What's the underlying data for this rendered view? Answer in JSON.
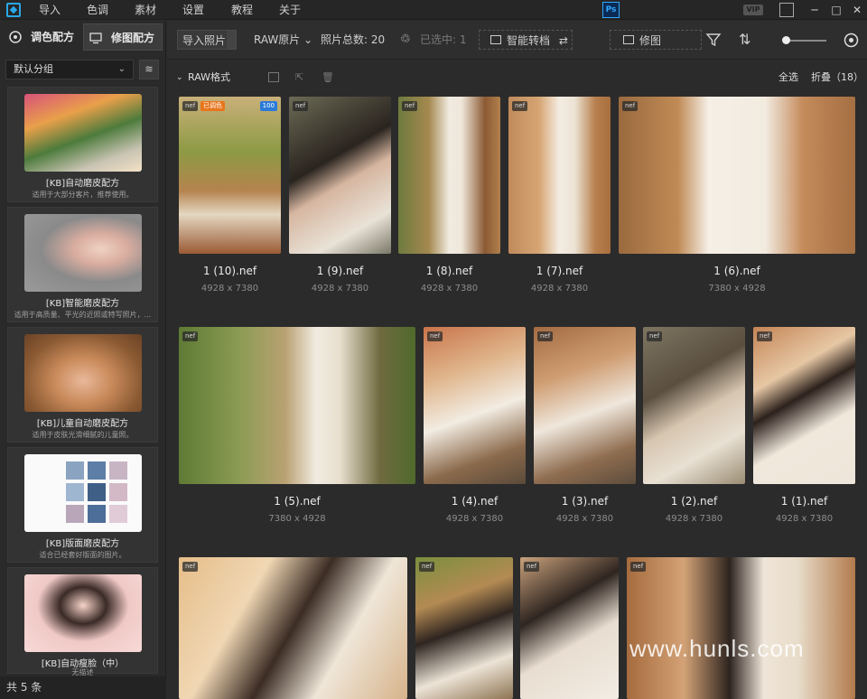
{
  "menubar": {
    "items": [
      "导入",
      "色调",
      "素材",
      "设置",
      "教程",
      "关于"
    ],
    "ps_label": "Ps",
    "vip_label": "VIP",
    "window_buttons": [
      "─",
      "□",
      "✕"
    ]
  },
  "sidebar": {
    "tabs": [
      {
        "label": "调色配方"
      },
      {
        "label": "修图配方"
      }
    ],
    "group_select": {
      "value": "默认分组"
    },
    "presets": [
      {
        "name": "[KB]自动磨皮配方",
        "desc": "适用于大部分客片，推荐使用。"
      },
      {
        "name": "[KB]智能磨皮配方",
        "desc": "适用于高质量、平光的近照或特写照片，..."
      },
      {
        "name": "[KB]儿童自动磨皮配方",
        "desc": "适用于皮肤光滑细腻的儿童照。"
      },
      {
        "name": "[KB]版面磨皮配方",
        "desc": "适合已经套好版面的图片。"
      },
      {
        "name": "[KB]自动瘦脸（中）",
        "desc": "无描述"
      }
    ],
    "footer": "共 5 条"
  },
  "toolbar": {
    "import_label": "导入照片",
    "raw_select": "RAW原片",
    "total_label": "照片总数:",
    "total_value": "20",
    "selected_label": "已选中:",
    "selected_value": "1",
    "smart_label": "智能转档",
    "retouch_label": "修图"
  },
  "section": {
    "title": "RAW格式",
    "select_all": "全选",
    "collapse": "折叠（18）"
  },
  "photos": [
    {
      "name": "1 (10).nef",
      "dims": "4928 x 7380",
      "badge": "nef",
      "status": "已调色",
      "score": "100"
    },
    {
      "name": "1 (9).nef",
      "dims": "4928 x 7380",
      "badge": "nef"
    },
    {
      "name": "1 (8).nef",
      "dims": "4928 x 7380",
      "badge": "nef"
    },
    {
      "name": "1 (7).nef",
      "dims": "4928 x 7380",
      "badge": "nef"
    },
    {
      "name": "1 (6).nef",
      "dims": "7380 x 4928",
      "badge": "nef"
    },
    {
      "name": "1 (5).nef",
      "dims": "7380 x 4928",
      "badge": "nef"
    },
    {
      "name": "1 (4).nef",
      "dims": "4928 x 7380",
      "badge": "nef"
    },
    {
      "name": "1 (3).nef",
      "dims": "4928 x 7380",
      "badge": "nef"
    },
    {
      "name": "1 (2).nef",
      "dims": "4928 x 7380",
      "badge": "nef"
    },
    {
      "name": "1 (1).nef",
      "dims": "4928 x 7380",
      "badge": "nef"
    },
    {
      "badge": "nef"
    },
    {
      "badge": "nef"
    },
    {
      "badge": "nef"
    },
    {
      "badge": "nef"
    }
  ],
  "watermark": "www.hunls.com",
  "colors": {
    "accent": "#2aa7e8",
    "status_orange": "#e8761e",
    "score_blue": "#2b7bd9"
  }
}
